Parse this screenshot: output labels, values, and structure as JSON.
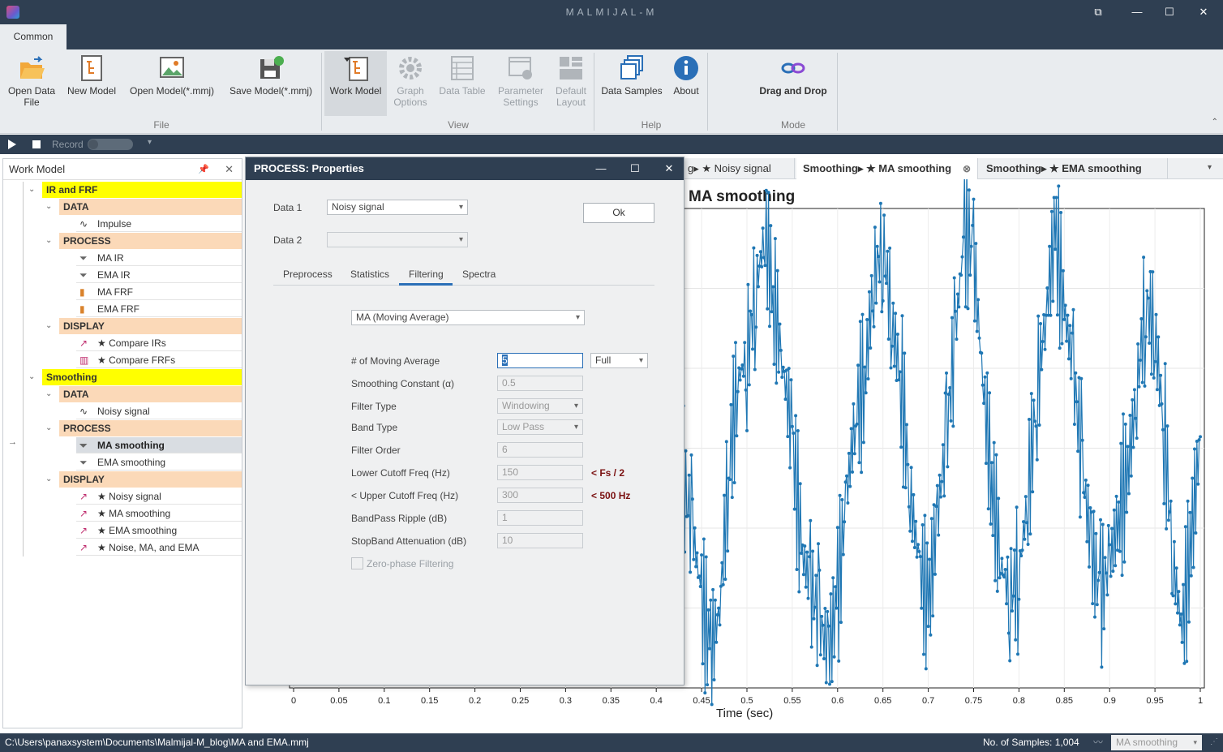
{
  "app": {
    "title": "MALMIJAL-M"
  },
  "ribbon": {
    "tab": "Common",
    "buttons": {
      "open_data_file": "Open Data\nFile",
      "new_model": "New Model",
      "open_model": "Open Model(*.mmj)",
      "save_model": "Save Model(*.mmj)",
      "work_model": "Work Model",
      "graph_options": "Graph\nOptions",
      "data_table": "Data Table",
      "parameter_settings": "Parameter\nSettings",
      "default_layout": "Default\nLayout",
      "data_samples": "Data Samples",
      "about": "About",
      "drag_and_drop": "Drag and Drop"
    },
    "groups": {
      "file": "File",
      "view": "View",
      "help": "Help",
      "mode": "Mode"
    }
  },
  "toolbar": {
    "record": "Record"
  },
  "work_model": {
    "title": "Work Model",
    "groups": [
      {
        "name": "IR and FRF",
        "data": [
          "Impulse"
        ],
        "process": [
          "MA IR",
          "EMA IR",
          "MA FRF",
          "EMA FRF"
        ],
        "display": [
          "★ Compare IRs",
          "★ Compare FRFs"
        ]
      },
      {
        "name": "Smoothing",
        "data": [
          "Noisy signal"
        ],
        "process": [
          "MA smoothing",
          "EMA smoothing"
        ],
        "display": [
          "★ Noisy signal",
          "★ MA smoothing",
          "★ EMA smoothing",
          "★ Noise, MA, and EMA"
        ]
      }
    ],
    "labels": {
      "data": "DATA",
      "process": "PROCESS",
      "display": "DISPLAY"
    }
  },
  "doc_tabs": [
    "g▸ ★ Noisy signal",
    "Smoothing▸ ★ MA smoothing",
    "Smoothing▸ ★ EMA smoothing"
  ],
  "dialog": {
    "title": "PROCESS: Properties",
    "data1_label": "Data 1",
    "data1_value": "Noisy signal",
    "data2_label": "Data 2",
    "data2_value": "",
    "ok": "Ok",
    "tabs": [
      "Preprocess",
      "Statistics",
      "Filtering",
      "Spectra"
    ],
    "active_tab": "Filtering",
    "method": "MA (Moving Average)",
    "rows": [
      {
        "label": "# of Moving Average",
        "value": "5",
        "extra": "Full"
      },
      {
        "label": "Smoothing Constant (α)",
        "value": "0.5"
      },
      {
        "label": "Filter Type",
        "value": "Windowing"
      },
      {
        "label": "Band Type",
        "value": "Low Pass"
      },
      {
        "label": "Filter Order",
        "value": "6"
      },
      {
        "label": "Lower Cutoff Freq (Hz)",
        "value": "150",
        "note": "<  Fs / 2"
      },
      {
        "label": "< Upper Cutoff Freq (Hz)",
        "value": "300",
        "note": "<  500 Hz"
      },
      {
        "label": "BandPass Ripple (dB)",
        "value": "1"
      },
      {
        "label": "StopBand Attenuation (dB)",
        "value": "10"
      }
    ],
    "zero_phase": "Zero-phase Filtering"
  },
  "chart_data": {
    "type": "line",
    "title": "MA smoothing",
    "xlabel": "Time (sec)",
    "ylabel": "",
    "xlim": [
      0,
      1
    ],
    "ylim": [
      -2.1,
      2.1
    ],
    "xticks": [
      "0",
      "0.05",
      "0.1",
      "0.15",
      "0.2",
      "0.25",
      "0.3",
      "0.35",
      "0.4",
      "0.45",
      "0.5",
      "0.55",
      "0.6",
      "0.65",
      "0.7",
      "0.75",
      "0.8",
      "0.85",
      "0.9",
      "0.95",
      "1"
    ],
    "series": [
      {
        "name": "",
        "color": "#1f77b4",
        "x": [
          0.4,
          0.41,
          0.42,
          0.43,
          0.44,
          0.45,
          0.46,
          0.47,
          0.48,
          0.49,
          0.5,
          0.51,
          0.52,
          0.53,
          0.54,
          0.55,
          0.56,
          0.57,
          0.58,
          0.59,
          0.6,
          0.61,
          0.62,
          0.63,
          0.64,
          0.65,
          0.66,
          0.67,
          0.68,
          0.69,
          0.7,
          0.71,
          0.72,
          0.73,
          0.74,
          0.75,
          0.76,
          0.77,
          0.78,
          0.79,
          0.8,
          0.81,
          0.82,
          0.83,
          0.84,
          0.85,
          0.86,
          0.87,
          0.88,
          0.89,
          0.9,
          0.91,
          0.92,
          0.93,
          0.94,
          0.95,
          0.96,
          0.97,
          0.98,
          0.99,
          1.0
        ],
        "y": [
          1.0,
          0.9,
          0.2,
          -0.3,
          -0.7,
          -1.3,
          -1.8,
          -1.4,
          -0.2,
          0.6,
          0.8,
          1.4,
          1.9,
          1.3,
          0.7,
          0.1,
          -0.9,
          -1.2,
          -1.5,
          -1.8,
          -1.3,
          -0.4,
          0.3,
          0.6,
          1.5,
          1.8,
          1.1,
          0.6,
          -0.4,
          -1.0,
          -1.4,
          -0.6,
          0.1,
          1.0,
          1.9,
          1.7,
          0.6,
          -0.3,
          -1.0,
          -1.3,
          -1.1,
          -0.4,
          0.5,
          1.2,
          1.9,
          1.2,
          0.7,
          -0.2,
          -0.9,
          -1.3,
          -1.0,
          -0.6,
          -0.2,
          0.5,
          1.3,
          1.0,
          0.2,
          -1.0,
          -1.6,
          -0.8,
          0.1
        ]
      }
    ]
  },
  "status": {
    "path": "C:\\Users\\panaxsystem\\Documents\\Malmijal-M_blog\\MA and EMA.mmj",
    "samples": "No. of Samples: 1,004",
    "selector": "MA smoothing"
  }
}
